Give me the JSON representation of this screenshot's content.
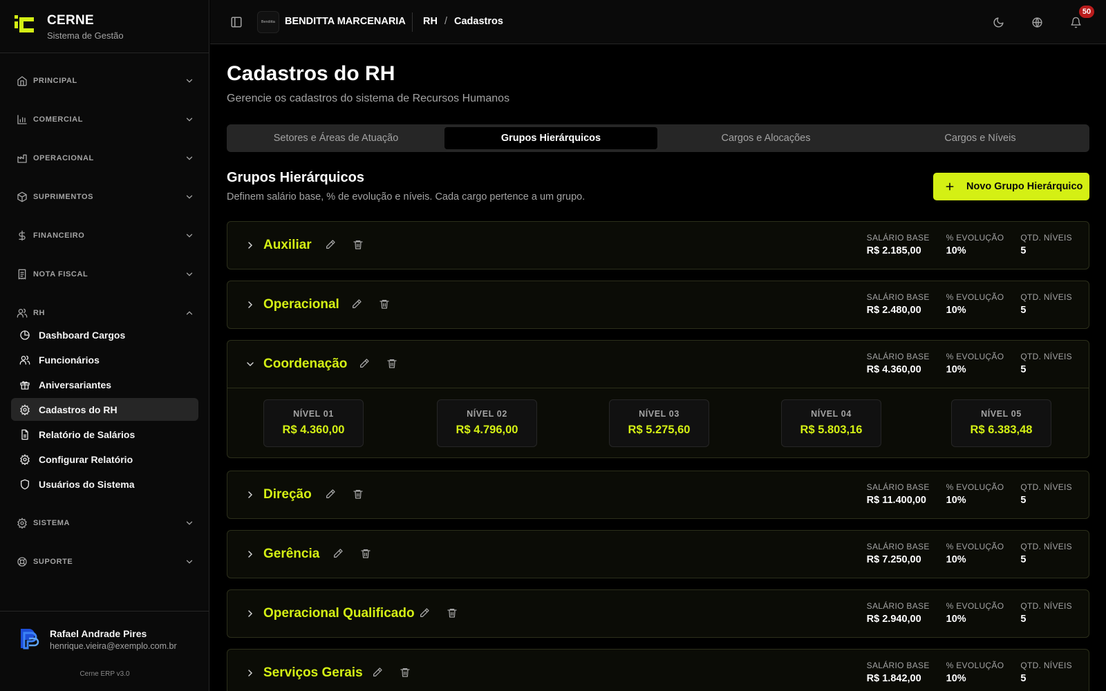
{
  "brand": {
    "name": "CERNE",
    "subtitle": "Sistema de Gestão",
    "accent": "#d4f014"
  },
  "sidebar": {
    "sections": [
      {
        "label": "PRINCIPAL",
        "icon": "home-icon"
      },
      {
        "label": "COMERCIAL",
        "icon": "bar-chart-icon"
      },
      {
        "label": "OPERACIONAL",
        "icon": "factory-icon"
      },
      {
        "label": "SUPRIMENTOS",
        "icon": "package-icon"
      },
      {
        "label": "FINANCEIRO",
        "icon": "dollar-icon"
      },
      {
        "label": "NOTA FISCAL",
        "icon": "receipt-icon"
      },
      {
        "label": "RH",
        "icon": "users-icon"
      },
      {
        "label": "SISTEMA",
        "icon": "gear-icon"
      },
      {
        "label": "SUPORTE",
        "icon": "lifebuoy-icon"
      }
    ],
    "rh_items": [
      {
        "label": "Dashboard Cargos",
        "icon": "pie-chart-icon"
      },
      {
        "label": "Funcionários",
        "icon": "users-icon"
      },
      {
        "label": "Aniversariantes",
        "icon": "gift-icon"
      },
      {
        "label": "Cadastros do RH",
        "icon": "gear-icon",
        "active": true
      },
      {
        "label": "Relatório de Salários",
        "icon": "file-icon"
      },
      {
        "label": "Configurar Relatório",
        "icon": "gear-icon"
      },
      {
        "label": "Usuários do Sistema",
        "icon": "shield-icon"
      }
    ],
    "user": {
      "name": "Rafael Andrade Pires",
      "email": "henrique.vieira@exemplo.com.br"
    },
    "version": "Cerne ERP v3.0"
  },
  "header": {
    "company_logo_text": "Benditta",
    "company": "BENDITTA MARCENARIA",
    "breadcrumb": [
      "RH",
      "Cadastros"
    ],
    "breadcrumb_sep": "/",
    "notifications": "50"
  },
  "page": {
    "title": "Cadastros do RH",
    "subtitle": "Gerencie os cadastros do sistema de Recursos Humanos",
    "tabs": [
      {
        "label": "Setores e Áreas de Atuação"
      },
      {
        "label": "Grupos Hierárquicos",
        "active": true
      },
      {
        "label": "Cargos e Alocações"
      },
      {
        "label": "Cargos e Níveis"
      }
    ],
    "section_title": "Grupos Hierárquicos",
    "section_subtitle": "Definem salário base, % de evolução e níveis. Cada cargo pertence a um grupo.",
    "add_button": "Novo Grupo Hierárquico",
    "stat_labels": {
      "base": "SALÁRIO BASE",
      "evolution": "% EVOLUÇÃO",
      "levels": "QTD. NÍVEIS"
    }
  },
  "groups": [
    {
      "name": "Auxiliar",
      "base": "R$ 2.185,00",
      "evolution": "10%",
      "levels": "5"
    },
    {
      "name": "Operacional",
      "base": "R$ 2.480,00",
      "evolution": "10%",
      "levels": "5"
    },
    {
      "name": "Coordenação",
      "base": "R$ 4.360,00",
      "evolution": "10%",
      "levels": "5",
      "expanded": true,
      "level_items": [
        {
          "label": "NÍVEL 01",
          "value": "R$ 4.360,00"
        },
        {
          "label": "NÍVEL 02",
          "value": "R$ 4.796,00"
        },
        {
          "label": "NÍVEL 03",
          "value": "R$ 5.275,60"
        },
        {
          "label": "NÍVEL 04",
          "value": "R$ 5.803,16"
        },
        {
          "label": "NÍVEL 05",
          "value": "R$ 6.383,48"
        }
      ]
    },
    {
      "name": "Direção",
      "base": "R$ 11.400,00",
      "evolution": "10%",
      "levels": "5"
    },
    {
      "name": "Gerência",
      "base": "R$ 7.250,00",
      "evolution": "10%",
      "levels": "5"
    },
    {
      "name": "Operacional Qualificado",
      "base": "R$ 2.940,00",
      "evolution": "10%",
      "levels": "5"
    },
    {
      "name": "Serviços Gerais",
      "base": "R$ 1.842,00",
      "evolution": "10%",
      "levels": "5"
    }
  ]
}
